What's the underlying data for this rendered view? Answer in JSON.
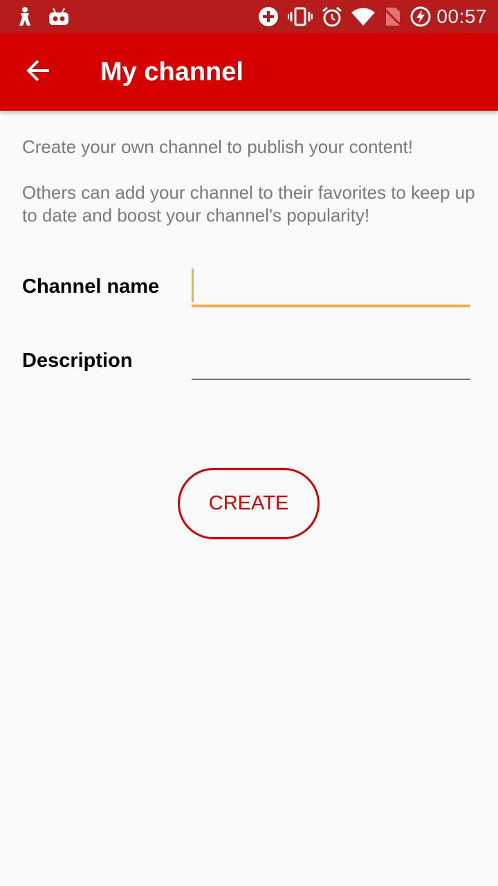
{
  "status_bar": {
    "time": "00:57",
    "icons": [
      "app-notification-icon",
      "robot-notification-icon",
      "add-circle-icon",
      "vibrate-icon",
      "alarm-icon",
      "wifi-icon",
      "no-sim-icon",
      "battery-charging-icon"
    ]
  },
  "app_bar": {
    "title": "My channel",
    "back_icon": "arrow-back-icon"
  },
  "intro": {
    "line1": "Create your own channel to publish your content!",
    "line2": "Others can add your channel to their favorites to keep up to date and boost your channel's popularity!"
  },
  "form": {
    "channel_name_label": "Channel name",
    "channel_name_value": "",
    "description_label": "Description",
    "description_value": ""
  },
  "create_button": {
    "label": "CREATE"
  },
  "colors": {
    "status_bar": "#b71c1c",
    "app_bar": "#d50000",
    "accent": "#f0ad4e",
    "button": "#d50000",
    "muted_text": "#7a7a7a"
  }
}
